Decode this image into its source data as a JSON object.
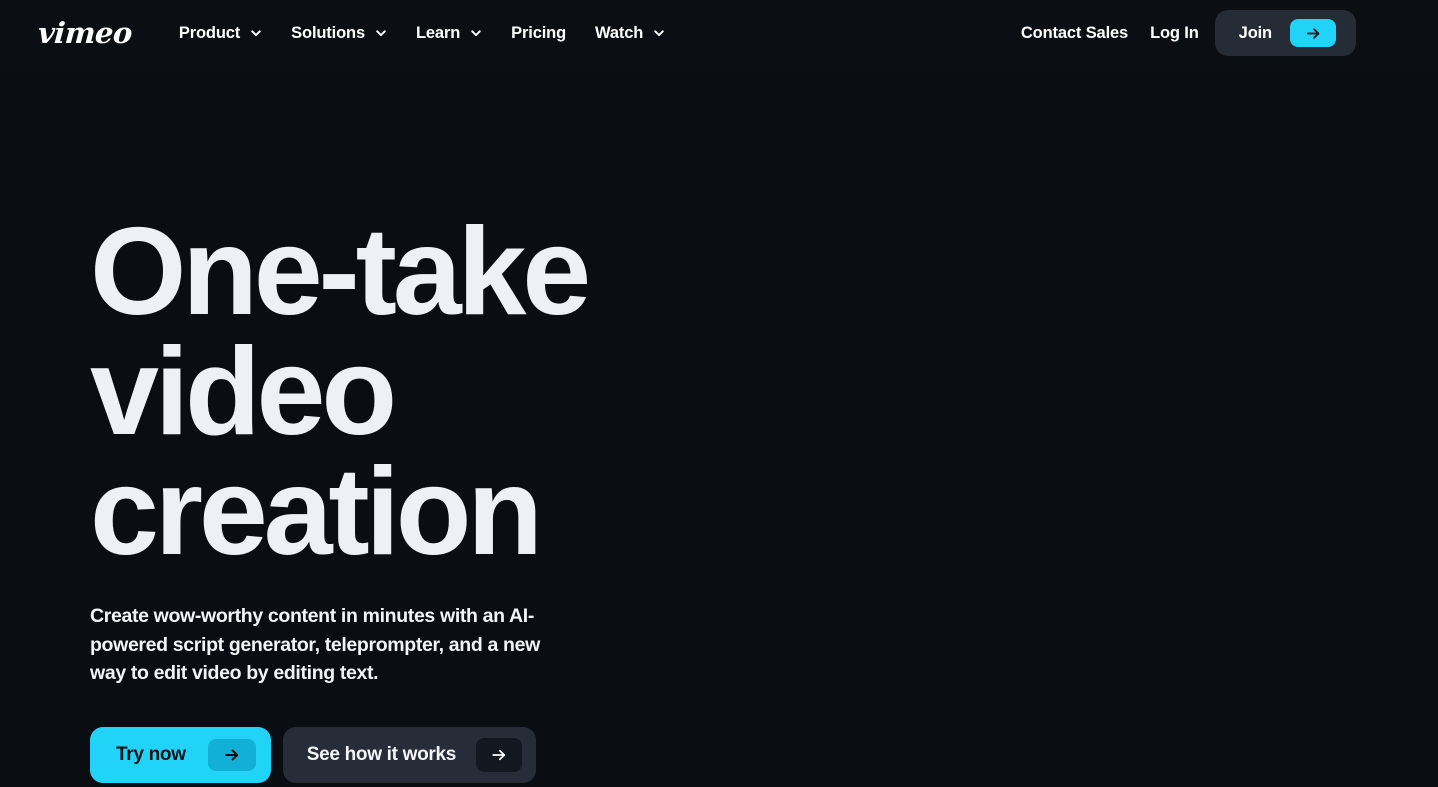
{
  "theme": {
    "background": "#0A0D12",
    "accent_cyan": "#22D3F8",
    "surface_dark": "#262C36",
    "text_primary": "#EDF1F6"
  },
  "header": {
    "brand": "vimeo",
    "brand_icon": "vimeo-wordmark",
    "nav_items": [
      {
        "label": "Product",
        "has_dropdown": true,
        "icon": "chevron-down-icon"
      },
      {
        "label": "Solutions",
        "has_dropdown": true,
        "icon": "chevron-down-icon"
      },
      {
        "label": "Learn",
        "has_dropdown": true,
        "icon": "chevron-down-icon"
      },
      {
        "label": "Pricing",
        "has_dropdown": false,
        "icon": ""
      },
      {
        "label": "Watch",
        "has_dropdown": true,
        "icon": "chevron-down-icon"
      }
    ],
    "contact_sales": "Contact Sales",
    "log_in": "Log In",
    "join": "Join",
    "join_icon": "arrow-right-icon"
  },
  "hero": {
    "title": "One-take video creation",
    "subtitle": "Create wow-worthy content in minutes with an AI-powered script generator, teleprompter, and a new way to edit video by editing text.",
    "primary_cta": "Try now",
    "primary_cta_icon": "arrow-right-icon",
    "secondary_cta": "See how it works",
    "secondary_cta_icon": "arrow-right-icon"
  }
}
